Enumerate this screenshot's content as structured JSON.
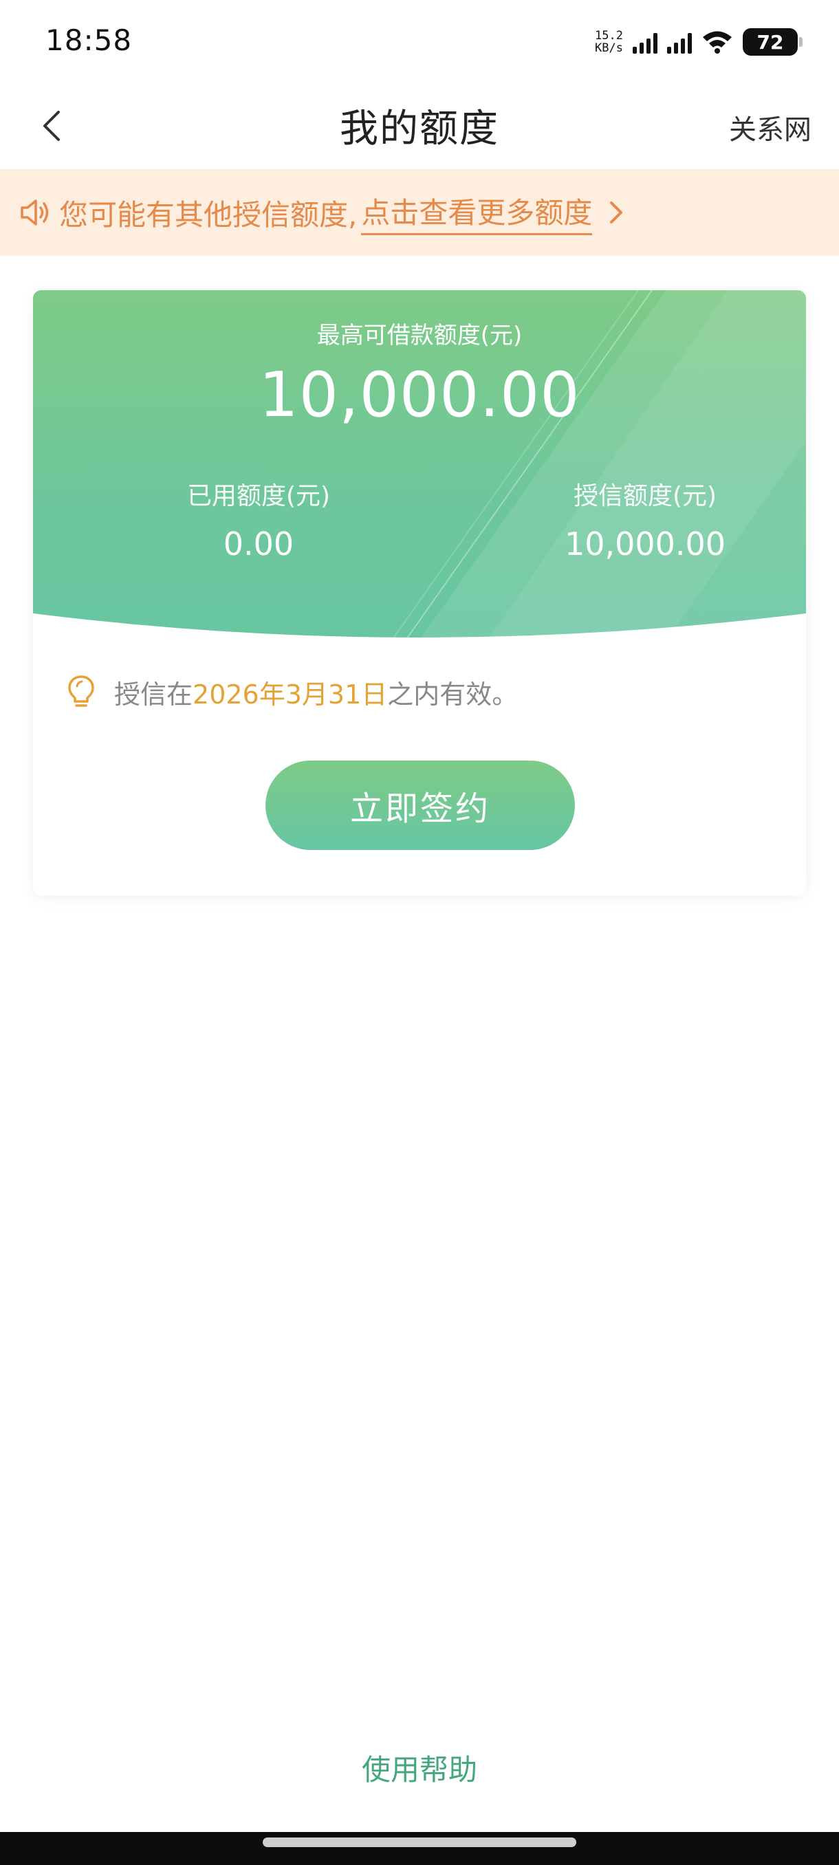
{
  "status_bar": {
    "time": "18:58",
    "net_speed_value": "15.2",
    "net_speed_unit": "KB/s",
    "battery": "72"
  },
  "header": {
    "title": "我的额度",
    "right_link": "关系网",
    "back_icon": "chevron-left-icon"
  },
  "notice": {
    "text": "您可能有其他授信额度,",
    "link": "点击查看更多额度",
    "icon": "speaker-icon",
    "color": "#e48a4a",
    "background": "#fdeee0"
  },
  "credit_card": {
    "limit_label": "最高可借款额度(元)",
    "limit_value": "10,000.00",
    "used_label": "已用额度(元)",
    "used_value": "0.00",
    "granted_label": "授信额度(元)",
    "granted_value": "10,000.00",
    "gradient_colors": [
      "#7ecb86",
      "#66c6a2"
    ]
  },
  "validity": {
    "prefix": "授信在",
    "date": "2026年3月31日",
    "suffix": "之内有效。",
    "icon": "lightbulb-icon",
    "date_color": "#e3a336"
  },
  "actions": {
    "sign_button": "立即签约"
  },
  "footer": {
    "help_link": "使用帮助"
  }
}
